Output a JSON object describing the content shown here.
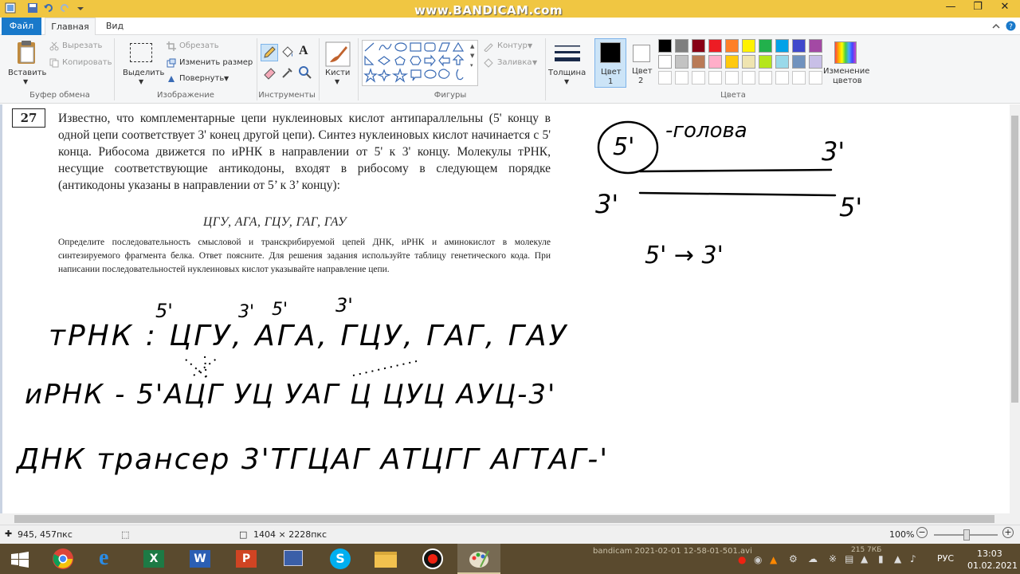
{
  "watermark": "www.BANDICAM.com",
  "tabs": {
    "file": "Файл",
    "home": "Главная",
    "view": "Вид"
  },
  "ribbon": {
    "clipboard": {
      "paste": "Вставить",
      "cut": "Вырезать",
      "copy": "Копировать",
      "group": "Буфер обмена"
    },
    "image": {
      "select": "Выделить",
      "crop": "Обрезать",
      "resize": "Изменить размер",
      "rotate": "Повернуть",
      "group": "Изображение"
    },
    "tools": {
      "group": "Инструменты"
    },
    "brushes": {
      "label": "Кисти"
    },
    "shapes": {
      "outline": "Контур",
      "fill": "Заливка",
      "group": "Фигуры"
    },
    "thickness": {
      "label": "Толщина"
    },
    "colors": {
      "color1": "Цвет",
      "color1_num": "1",
      "color2": "Цвет",
      "color2_num": "2",
      "edit": "Изменение",
      "edit2": "цветов",
      "group": "Цвета",
      "palette_row1": [
        "#000000",
        "#7f7f7f",
        "#880015",
        "#ed1c24",
        "#ff7f27",
        "#fff200",
        "#22b14c",
        "#00a2e8",
        "#3f48cc",
        "#a349a4"
      ],
      "palette_row2": [
        "#ffffff",
        "#c3c3c3",
        "#b97a57",
        "#ffaec9",
        "#ffc90e",
        "#efe4b0",
        "#b5e61d",
        "#99d9ea",
        "#7092be",
        "#c8bfe7"
      ]
    }
  },
  "task": {
    "number": "27",
    "body": "Известно, что комплементарные цепи нуклеиновых кислот антипараллельны (5' концу в одной цепи соответствует 3' конец другой цепи). Синтез нуклеиновых кислот начинается с 5' конца. Рибосома движется по иРНК в направлении от 5' к 3' концу. Молекулы тРНК, несущие соответствующие антикодоны, входят в рибосому в следующем порядке (антикодоны указаны в направлении от 5’ к 3’ концу):",
    "anticodons": "ЦГУ, АГА, ГЦУ, ГАГ, ГАУ",
    "instruction": "Определите последовательность смысловой и транскрибируемой цепей ДНК, иРНК и аминокислот в молекуле синтезируемого фрагмента белка. Ответ поясните. Для решения задания используйте таблицу генетического кода. При написании последовательностей нуклеиновых кислот указывайте направление цепи."
  },
  "handwriting": {
    "head_5": "5'",
    "head_label": "-голова",
    "top_3": "3'",
    "bot_3": "3'",
    "bot_5": "5'",
    "arrow": "5' → 3'",
    "mark_5a": "5'",
    "mark_3a": "3'",
    "mark_5b": "5'",
    "mark_3b": "3'",
    "trna": "тРНК : ЦГУ, АГА, ГЦУ, ГАГ, ГАУ",
    "mrna": "иРНК - 5'АЦГ УЦ УАГ Ц ЦУЦ АУЦ-3'",
    "dna": "ДНК трансер 3'ТГЦАГ АТЦГГ АГТАГ-'"
  },
  "status": {
    "cursor_pos": "945, 457пкс",
    "image_size": "1404 × 2228пкс",
    "zoom": "100%"
  },
  "taskbar": {
    "bandicam_title": "bandicam 2021-02-01 12-58-01-501.avi",
    "file_size": "215 7КБ",
    "lang": "РУС",
    "time": "13:03",
    "date": "01.02.2021"
  }
}
